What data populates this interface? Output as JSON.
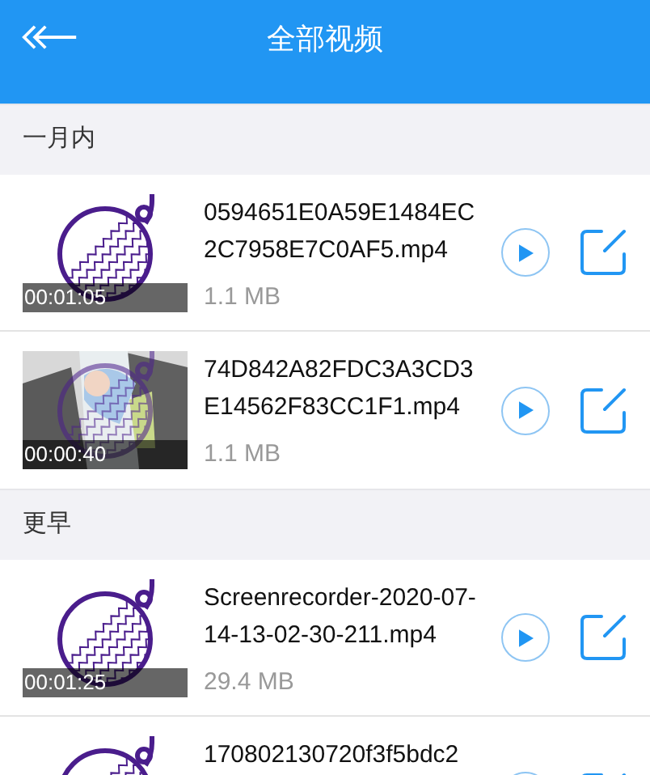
{
  "header": {
    "title": "全部视频"
  },
  "sections": [
    {
      "title": "一月内",
      "videos": [
        {
          "kind": "logo",
          "duration": "00:01:05",
          "name": "0594651E0A59E1484EC2C7958E7C0AF5.mp4",
          "size": "1.1 MB"
        },
        {
          "kind": "picture",
          "duration": "00:00:40",
          "name": "74D842A82FDC3A3CD3E14562F83CC1F1.mp4",
          "size": "1.1 MB"
        }
      ]
    },
    {
      "title": "更早",
      "videos": [
        {
          "kind": "logo",
          "duration": "00:01:25",
          "name": "Screenrecorder-2020-07-14-13-02-30-211.mp4",
          "size": "29.4 MB"
        },
        {
          "kind": "logo",
          "name": "170802130720f3f5bdc2"
        }
      ]
    }
  ]
}
